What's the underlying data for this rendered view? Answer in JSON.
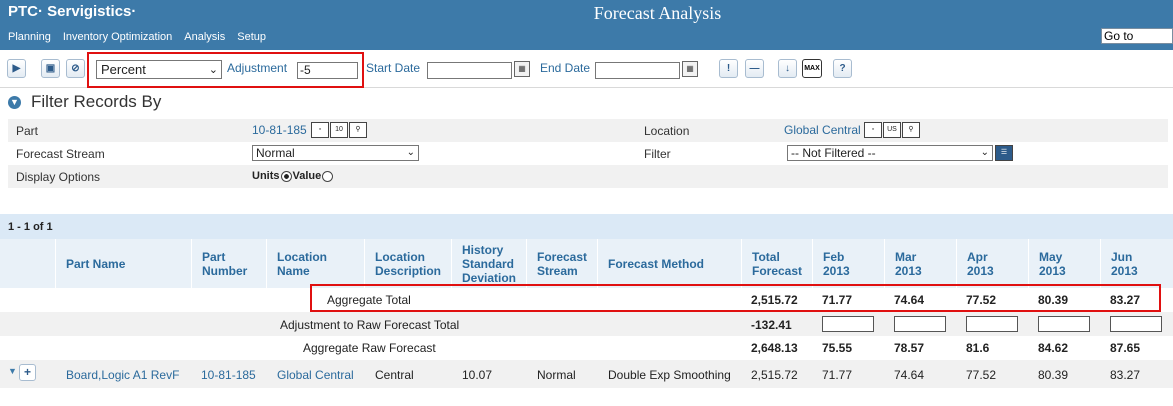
{
  "header": {
    "brand": "PTC· Servigistics·",
    "title": "Forecast Analysis",
    "nav": [
      "Planning",
      "Inventory Optimization",
      "Analysis",
      "Setup"
    ],
    "goto_value": "Go to"
  },
  "toolbar": {
    "mode_value": "Percent",
    "adjustment_label": "Adjustment",
    "adjustment_value": "-5",
    "start_date_label": "Start Date",
    "start_date_value": "",
    "end_date_label": "End Date",
    "end_date_value": "",
    "max_label": "MAX",
    "help_label": "?"
  },
  "filter": {
    "title": "Filter Records By",
    "part_label": "Part",
    "part_value": "10-81-185",
    "location_label": "Location",
    "location_value": "Global Central",
    "stream_label": "Forecast Stream",
    "stream_value": "Normal",
    "filter_label": "Filter",
    "filter_value": "-- Not Filtered --",
    "display_label": "Display Options",
    "units_label": "Units",
    "value_label": "Value"
  },
  "results": {
    "count": "1 - 1 of 1",
    "columns": {
      "part_name": "Part Name",
      "part_number": [
        "Part",
        "Number"
      ],
      "location_name": [
        "Location",
        "Name"
      ],
      "location_desc": [
        "Location",
        "Description"
      ],
      "history_sd": [
        "History",
        "Standard",
        "Deviation"
      ],
      "forecast_stream": [
        "Forecast",
        "Stream"
      ],
      "forecast_method": "Forecast Method",
      "total_forecast": [
        "Total",
        "Forecast"
      ],
      "months": [
        [
          "Feb",
          "2013"
        ],
        [
          "Mar",
          "2013"
        ],
        [
          "Apr",
          "2013"
        ],
        [
          "May",
          "2013"
        ],
        [
          "Jun",
          "2013"
        ]
      ]
    },
    "aggregate_total": {
      "label": "Aggregate Total",
      "total": "2,515.72",
      "months": [
        "71.77",
        "74.64",
        "77.52",
        "80.39",
        "83.27"
      ]
    },
    "adjustment_row": {
      "label": "Adjustment to Raw Forecast Total",
      "total": "-132.41"
    },
    "raw_forecast": {
      "label": "Aggregate Raw Forecast",
      "total": "2,648.13",
      "months": [
        "75.55",
        "78.57",
        "81.6",
        "84.62",
        "87.65"
      ]
    },
    "data_row": {
      "part_name": "Board,Logic A1 RevF",
      "part_number": "10-81-185",
      "location_name": "Global Central",
      "location_desc": "Central",
      "history_sd": "10.07",
      "forecast_stream": "Normal",
      "forecast_method": "Double Exp Smoothing",
      "total": "2,515.72",
      "months": [
        "71.77",
        "74.64",
        "77.52",
        "80.39",
        "83.27"
      ]
    }
  }
}
